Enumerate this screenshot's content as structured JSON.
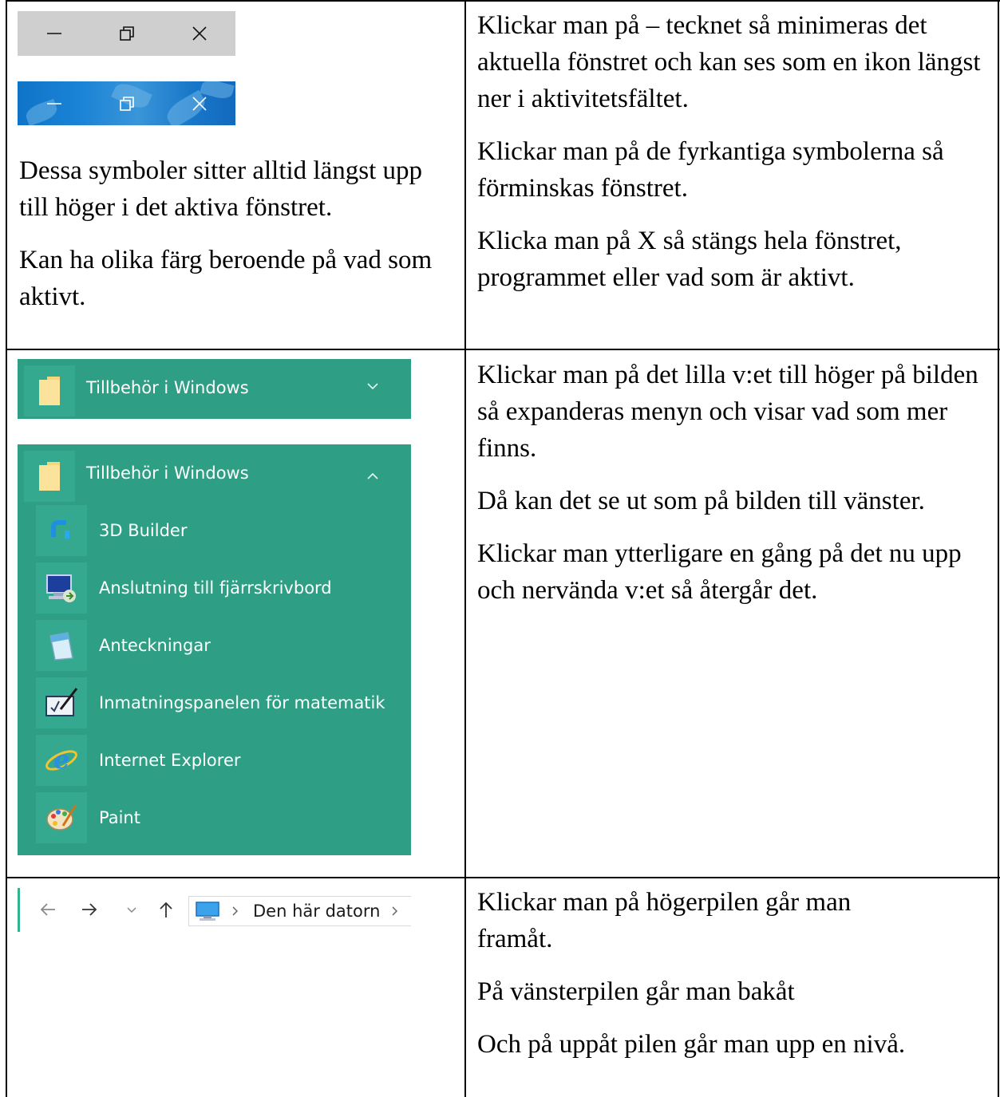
{
  "row1": {
    "left_paragraphs": [
      "Dessa symboler sitter alltid längst upp till höger i det aktiva fönstret.",
      "Kan ha olika färg beroende på vad som aktivt."
    ],
    "right_paragraphs": [
      "Klickar man på – tecknet så minimeras det aktuella fönstret och kan ses som en ikon längst ner i aktivitetsfältet.",
      "Klickar man på de fyrkantiga symbolerna så förminskas fönstret.",
      "Klicka man på X så stängs hela fönstret, programmet eller vad som är aktivt."
    ],
    "window_controls": {
      "icons": [
        "minimize-icon",
        "restore-icon",
        "close-icon"
      ],
      "grey_bar_color": "#cfcfcf",
      "blue_bar_color": "#1877c9"
    }
  },
  "row2": {
    "collapsed_menu": {
      "title": "Tillbehör i Windows",
      "chevron": "chevron-down-icon"
    },
    "expanded_menu": {
      "title": "Tillbehör i Windows",
      "chevron": "chevron-up-icon",
      "items": [
        {
          "label": "3D Builder",
          "icon": "3d-builder-icon"
        },
        {
          "label": "Anslutning till fjärrskrivbord",
          "icon": "remote-desktop-icon"
        },
        {
          "label": "Anteckningar",
          "icon": "notepad-icon"
        },
        {
          "label": "Inmatningspanelen för matematik",
          "icon": "math-input-icon"
        },
        {
          "label": "Internet Explorer",
          "icon": "internet-explorer-icon"
        },
        {
          "label": "Paint",
          "icon": "paint-icon"
        }
      ]
    },
    "menu_color": "#2e9e85",
    "right_paragraphs": [
      "Klickar man på det lilla v:et till höger på bilden så expanderas menyn och visar vad som mer finns.",
      "Då kan det se ut som på bilden till vänster.",
      "Klickar man ytterligare en gång på det nu upp och nervända v:et så återgår det."
    ]
  },
  "row3": {
    "nav": {
      "back": "back-arrow-icon",
      "forward": "forward-arrow-icon",
      "recent": "recent-dropdown-icon",
      "up": "up-arrow-icon",
      "location": "Den här datorn"
    },
    "right_paragraphs": [
      "Klickar man på högerpilen går man framåt.",
      "På vänsterpilen går man bakåt",
      "Och på uppåt pilen går man upp en nivå."
    ]
  }
}
